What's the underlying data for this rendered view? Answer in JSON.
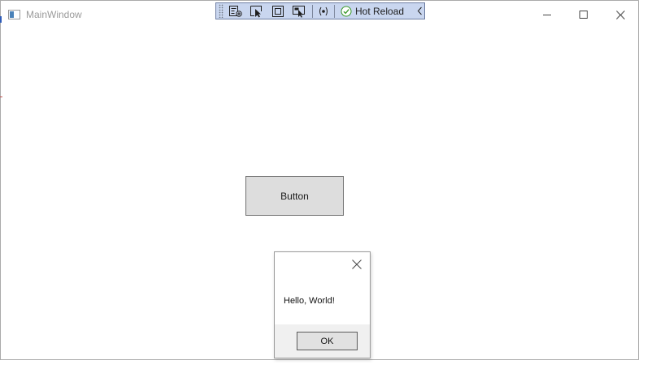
{
  "window": {
    "title": "MainWindow"
  },
  "toolbar": {
    "hot_reload_label": "Hot Reload",
    "icons": [
      "live-visual-tree-icon",
      "select-element-icon",
      "display-layout-adorners-icon",
      "track-focused-element-icon",
      "binding-failures-icon",
      "hot-reload-status-icon",
      "collapse-chevron-icon"
    ],
    "background": "#c9d6ef",
    "status_color": "#3c9a2c"
  },
  "main": {
    "button_label": "Button"
  },
  "message_box": {
    "text": "Hello, World!",
    "ok_label": "OK"
  }
}
